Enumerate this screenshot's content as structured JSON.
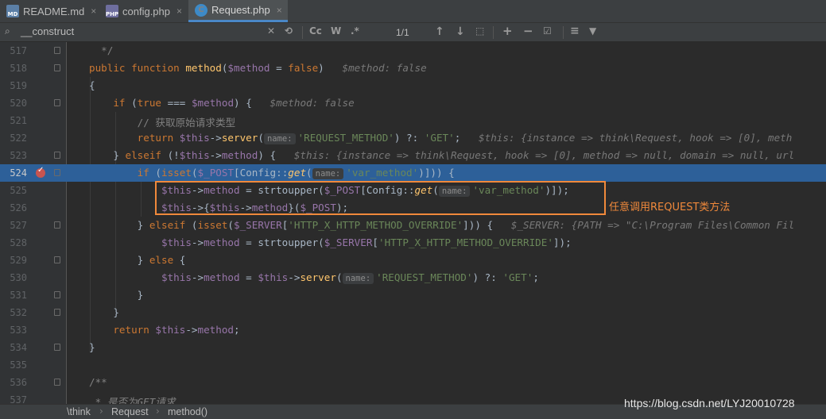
{
  "tabs": [
    {
      "label": "README.md",
      "icon": "markdown-file-icon",
      "close": "×",
      "active": false
    },
    {
      "label": "config.php",
      "icon": "php-file-icon",
      "close": "×",
      "active": false
    },
    {
      "label": "Request.php",
      "icon": "php-class-file-icon",
      "close": "×",
      "active": true
    }
  ],
  "tab_icon_text": {
    "md": "MD",
    "php": "PHP",
    "class": "C"
  },
  "search": {
    "query": "__construct",
    "match_count": "1/1",
    "buttons": {
      "match_case": "Cc",
      "words": "W",
      "regex": ".*"
    },
    "glyphs": {
      "search": "⌕",
      "clear": "✕",
      "history": "⟲",
      "prev": "↑",
      "next": "↓",
      "select_all": "⬚",
      "add_occurrence": "+",
      "remove_occurrence": "−",
      "select_all_occurrences": "☑",
      "options": "≡",
      "filter": "▼"
    }
  },
  "editor": {
    "current_line": 524,
    "lines": [
      {
        "n": 517,
        "text": "*/"
      },
      {
        "n": 518,
        "text": "public function method($method = false)   $method: false"
      },
      {
        "n": 519,
        "text": "{"
      },
      {
        "n": 520,
        "text": "if (true === $method) {   $method: false"
      },
      {
        "n": 521,
        "text": "// 获取原始请求类型"
      },
      {
        "n": 522,
        "text": "return $this->server( name: 'REQUEST_METHOD') ?: 'GET';   $this: {instance => think\\Request, hook => [0], meth"
      },
      {
        "n": 523,
        "text": "} elseif (!$this->method) {   $this: {instance => think\\Request, hook => [0], method => null, domain => null, url"
      },
      {
        "n": 524,
        "text": "if (isset($_POST[Config::get( name: 'var_method')])) {"
      },
      {
        "n": 525,
        "text": "$this->method = strtoupper($_POST[Config::get( name: 'var_method')]);"
      },
      {
        "n": 526,
        "text": "$this->{$this->method}($_POST);"
      },
      {
        "n": 527,
        "text": "} elseif (isset($_SERVER['HTTP_X_HTTP_METHOD_OVERRIDE'])) {   $_SERVER: {PATH => \"C:\\Program Files\\Common Fil"
      },
      {
        "n": 528,
        "text": "$this->method = strtoupper($_SERVER['HTTP_X_HTTP_METHOD_OVERRIDE']);"
      },
      {
        "n": 529,
        "text": "} else {"
      },
      {
        "n": 530,
        "text": "$this->method = $this->server( name: 'REQUEST_METHOD') ?: 'GET';"
      },
      {
        "n": 531,
        "text": "}"
      },
      {
        "n": 532,
        "text": "}"
      },
      {
        "n": 533,
        "text": "return $this->method;"
      },
      {
        "n": 534,
        "text": "}"
      },
      {
        "n": 535,
        "text": ""
      },
      {
        "n": 536,
        "text": "/**"
      },
      {
        "n": 537,
        "text": "* 是否为GET请求"
      }
    ],
    "param_hint_label": "name:"
  },
  "annotation": {
    "text": "任意调用REQUEST类方法",
    "color": "#f0893b"
  },
  "breadcrumbs": [
    "\\think",
    "Request",
    "method()"
  ],
  "breadcrumb_separator": "›",
  "watermark": "https://blog.csdn.net/LYJ20010728",
  "colors": {
    "background": "#2b2b2b",
    "keyword": "#cc7832",
    "function": "#ffc66d",
    "variable": "#9876aa",
    "string": "#6a8759",
    "comment": "#808080",
    "current_line": "#2d6099",
    "breakpoint": "#c75450"
  }
}
